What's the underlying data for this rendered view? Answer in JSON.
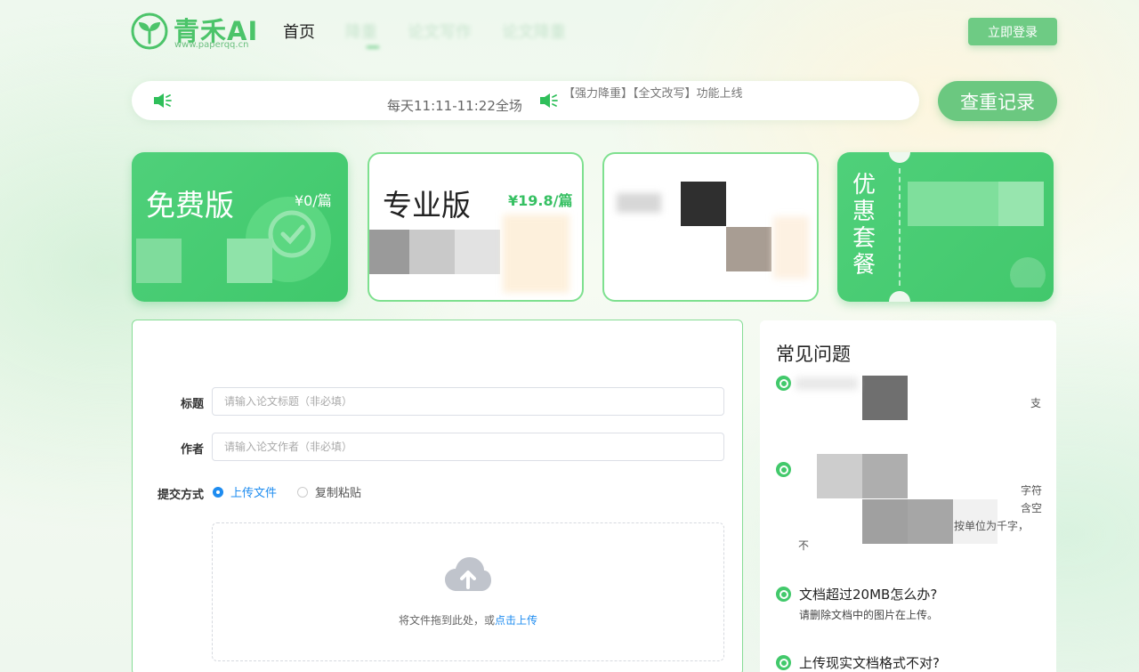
{
  "header": {
    "logo_name": "青禾AI",
    "logo_sub": "www.paperqq.cn",
    "nav": [
      {
        "label": "首页",
        "state": "normal"
      },
      {
        "label": "降重",
        "state": "active"
      },
      {
        "label": "论文写作",
        "state": "obscured"
      },
      {
        "label": "论文降重",
        "state": "obscured"
      }
    ],
    "login_label": "立即登录"
  },
  "notice": {
    "text1": "每天11:11-11:22全场",
    "text2": "【强力降重】【全文改写】功能上线",
    "speaker_icon": "speaker-icon"
  },
  "record_button": "查重记录",
  "plans": {
    "free": {
      "title": "免费版",
      "price": "¥0/篇"
    },
    "pro": {
      "title": "专业版",
      "price": "¥19.8/篇"
    },
    "package": {
      "title": "优惠套餐"
    }
  },
  "form": {
    "title_label": "标题",
    "title_placeholder": "请输入论文标题（非必填）",
    "author_label": "作者",
    "author_placeholder": "请输入论文作者（非必填）",
    "submit_label": "提交方式",
    "radio_upload": "上传文件",
    "radio_paste": "复制粘贴",
    "upload_hint": "将文件拖到此处，或",
    "upload_link": "点击上传"
  },
  "faq": {
    "title": "常见问题",
    "items": [
      {
        "question": "文档超过20MB怎么办?",
        "answer": "请删除文档中的图片在上传。"
      },
      {
        "question": "上传现实文档格式不对?"
      }
    ],
    "blur_fragments": [
      "支",
      "字符",
      "含空",
      "按单位为千字，",
      "不"
    ]
  },
  "colors": {
    "brand_green": "#48c06a",
    "accent_blue": "#1e8cf0"
  }
}
